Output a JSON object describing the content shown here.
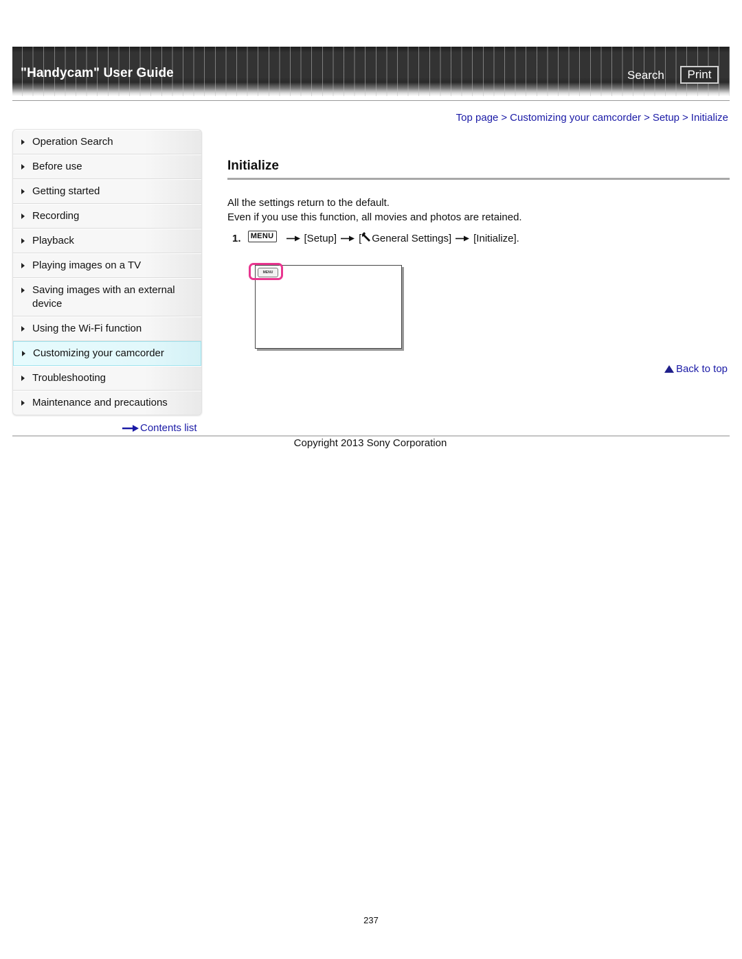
{
  "header": {
    "title": "\"Handycam\" User Guide",
    "search_label": "Search",
    "print_label": "Print"
  },
  "breadcrumb": {
    "items": [
      "Top page",
      "Customizing your camcorder",
      "Setup",
      "Initialize"
    ],
    "separator": ">"
  },
  "sidebar": {
    "items": [
      {
        "label": "Operation Search"
      },
      {
        "label": "Before use"
      },
      {
        "label": "Getting started"
      },
      {
        "label": "Recording"
      },
      {
        "label": "Playback"
      },
      {
        "label": "Playing images on a TV"
      },
      {
        "label": "Saving images with an external device"
      },
      {
        "label": "Using the Wi-Fi function"
      },
      {
        "label": "Customizing your camcorder",
        "active": true
      },
      {
        "label": "Troubleshooting"
      },
      {
        "label": "Maintenance and precautions"
      }
    ],
    "contents_list_label": "Contents list"
  },
  "main": {
    "title": "Initialize",
    "paragraphs": [
      "All the settings return to the default.",
      "Even if you use this function, all movies and photos are retained."
    ],
    "step": {
      "number": "1.",
      "menu_button_label": "MENU",
      "arrow": "→",
      "setup": "[Setup]",
      "general_open": "[",
      "general_settings": "General Settings]",
      "initialize": "[Initialize]."
    },
    "illustration": {
      "menu_label": "MENU",
      "highlight_color": "#e8368f"
    },
    "back_to_top_label": "Back to top"
  },
  "footer": {
    "copyright": "Copyright 2013 Sony Corporation",
    "page_number": "237"
  },
  "colors": {
    "link": "#1a1aa6",
    "active_nav_bg": "#e2f8fb",
    "active_nav_border": "#9fe3ee",
    "header_bg": "#333333"
  }
}
